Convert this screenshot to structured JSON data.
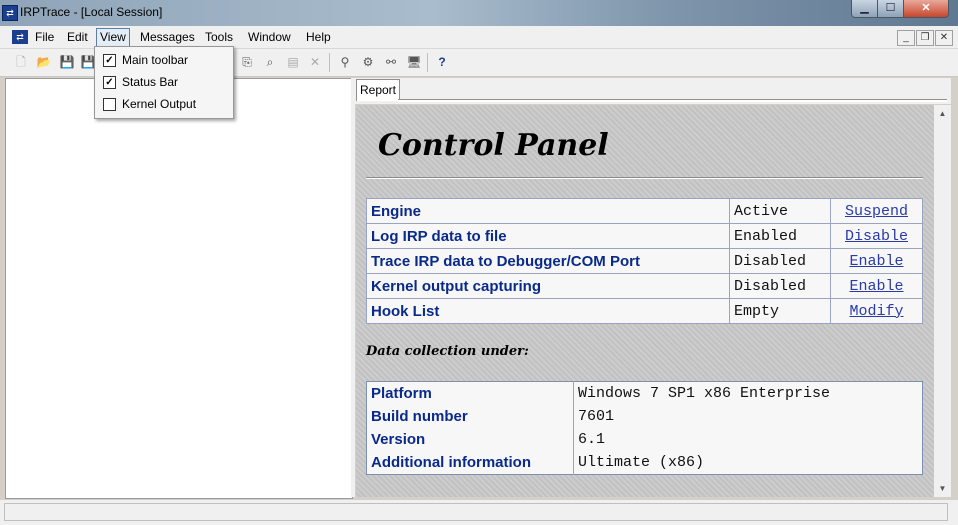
{
  "window": {
    "title": "IRPTrace - [Local Session]"
  },
  "menu": {
    "items": [
      "File",
      "Edit",
      "View",
      "Messages",
      "Tools",
      "Window",
      "Help"
    ]
  },
  "view_menu": {
    "items": [
      {
        "label": "Main toolbar",
        "checked": true
      },
      {
        "label": "Status Bar",
        "checked": true
      },
      {
        "label": "Kernel Output",
        "checked": false
      }
    ]
  },
  "tabs": {
    "report": "Report"
  },
  "control_panel": {
    "title": "Control Panel",
    "rows": [
      {
        "name": "Engine",
        "state": "Active",
        "action": "Suspend"
      },
      {
        "name": "Log IRP data to file",
        "state": "Enabled",
        "action": "Disable"
      },
      {
        "name": "Trace IRP data to Debugger/COM Port",
        "state": "Disabled",
        "action": "Enable"
      },
      {
        "name": "Kernel output capturing",
        "state": "Disabled",
        "action": "Enable"
      },
      {
        "name": "Hook List",
        "state": "Empty",
        "action": "Modify"
      }
    ],
    "section_label": "Data collection under:",
    "info": [
      {
        "name": "Platform",
        "value": "Windows 7 SP1 x86 Enterprise"
      },
      {
        "name": "Build number",
        "value": "7601"
      },
      {
        "name": "Version",
        "value": "6.1"
      },
      {
        "name": "Additional information",
        "value": "Ultimate (x86)"
      }
    ]
  },
  "colors": {
    "title_blue": "#0a2a8a",
    "link": "#2a3aa8",
    "report_bg": "#c9c9c9"
  }
}
